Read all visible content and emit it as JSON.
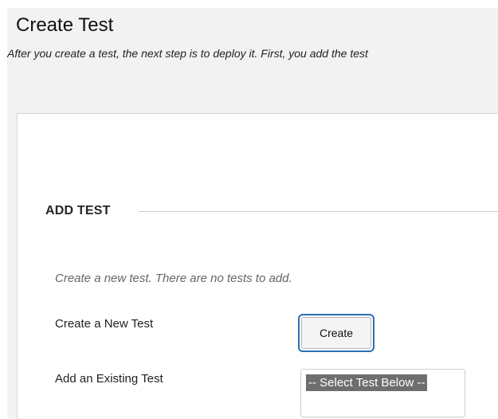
{
  "header": {
    "title": "Create Test",
    "subtitle": "After you create a test, the next step is to deploy it. First, you add the test"
  },
  "add_test": {
    "section_title": "ADD TEST",
    "instructions": "Create a new test. There are no tests to add.",
    "create_label": "Create a New Test",
    "create_button": "Create",
    "existing_label": "Add an Existing Test",
    "select_options": [
      "-- Select Test Below --"
    ]
  }
}
